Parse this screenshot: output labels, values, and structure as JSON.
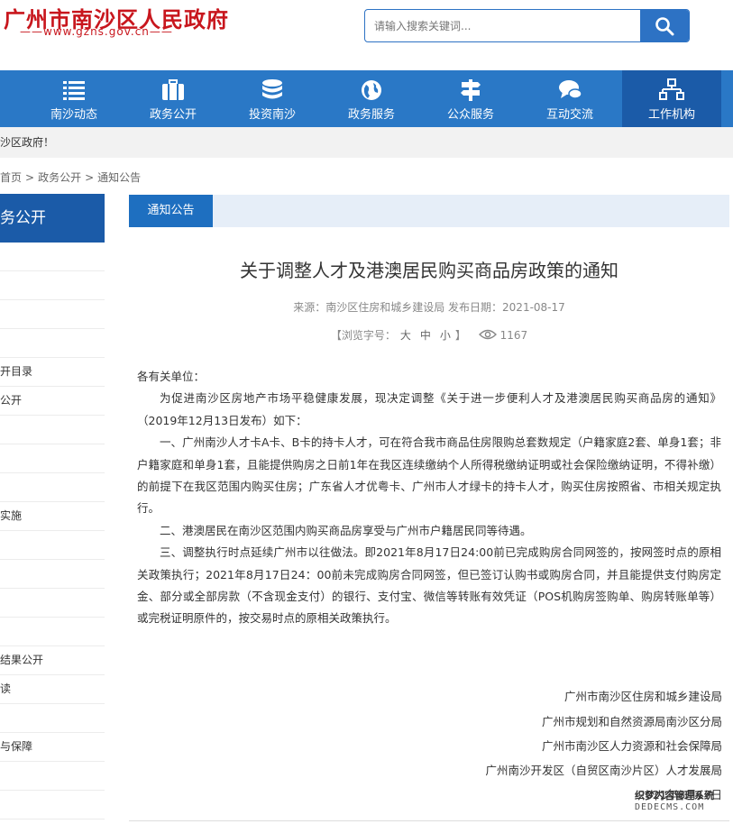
{
  "header": {
    "site_title": "广州市南沙区人民政府",
    "site_url": "——www.gzns.gov.cn——",
    "search_placeholder": "请输入搜索关键词..."
  },
  "nav": {
    "items": [
      {
        "label": "南沙动态",
        "icon": "list-icon"
      },
      {
        "label": "政务公开",
        "icon": "briefcase-icon"
      },
      {
        "label": "投资南沙",
        "icon": "database-icon"
      },
      {
        "label": "政务服务",
        "icon": "globe-icon"
      },
      {
        "label": "公众服务",
        "icon": "signpost-icon"
      },
      {
        "label": "互动交流",
        "icon": "chat-icon"
      },
      {
        "label": "工作机构",
        "icon": "org-chart-icon"
      }
    ],
    "active_index": 6
  },
  "notice": {
    "text": "沙区政府！"
  },
  "breadcrumb": {
    "home": "首页",
    "section": "政务公开",
    "current": "通知公告"
  },
  "sidebar": {
    "title": "务公开",
    "items": [
      "",
      "",
      "",
      "",
      "开目录",
      "公开",
      "",
      "",
      "",
      "实施",
      "",
      "",
      "",
      "",
      "结果公开",
      "读",
      "",
      "与保障",
      "",
      ""
    ]
  },
  "tab": {
    "label": "通知公告"
  },
  "article": {
    "title": "关于调整人才及港澳居民购买商品房政策的通知",
    "meta": "来源：南沙区住房和城乡建设局  发布日期：2021-08-17",
    "font_prefix": "【浏览字号：",
    "font_large": "大",
    "font_medium": "中",
    "font_small": "小",
    "font_suffix": "】",
    "views": "1167",
    "salutation": "各有关单位：",
    "paragraphs": [
      "为促进南沙区房地产市场平稳健康发展，现决定调整《关于进一步便利人才及港澳居民购买商品房的通知》（2019年12月13日发布）如下：",
      "一、广州南沙人才卡A卡、B卡的持卡人才，可在符合我市商品住房限购总套数规定（户籍家庭2套、单身1套；非户籍家庭和单身1套，且能提供购房之日前1年在我区连续缴纳个人所得税缴纳证明或社会保险缴纳证明，不得补缴）的前提下在我区范围内购买住房；广东省人才优粤卡、广州市人才绿卡的持卡人才，购买住房按照省、市相关规定执行。",
      "二、港澳居民在南沙区范围内购买商品房享受与广州市户籍居民同等待遇。",
      "三、调整执行时点延续广州市以往做法。即2021年8月17日24:00前已完成购房合同网签的，按网签时点的原相关政策执行；2021年8月17日24：00前未完成购房合同网签，但已签订认购书或购房合同，并且能提供支付购房定金、部分或全部房款（不含现金支付）的银行、支付宝、微信等转账有效凭证（POS机购房签购单、购房转账单等）或完税证明原件的，按交易时点的原相关政策执行。"
    ],
    "signatures": [
      "广州市南沙区住房和城乡建设局",
      "广州市规划和自然资源局南沙区分局",
      "广州市南沙区人力资源和社会保障局",
      "广州南沙开发区（自贸区南沙片区）人才发展局"
    ],
    "date": "2021年8月17日"
  },
  "watermark": {
    "line1": "织梦内容管理系统",
    "line2": "DEDECMS.COM"
  },
  "colors": {
    "brand_red": "#c8161d",
    "nav_blue": "#2a78c6",
    "nav_active": "#1b5ba8",
    "search_blue": "#2d72c4"
  }
}
